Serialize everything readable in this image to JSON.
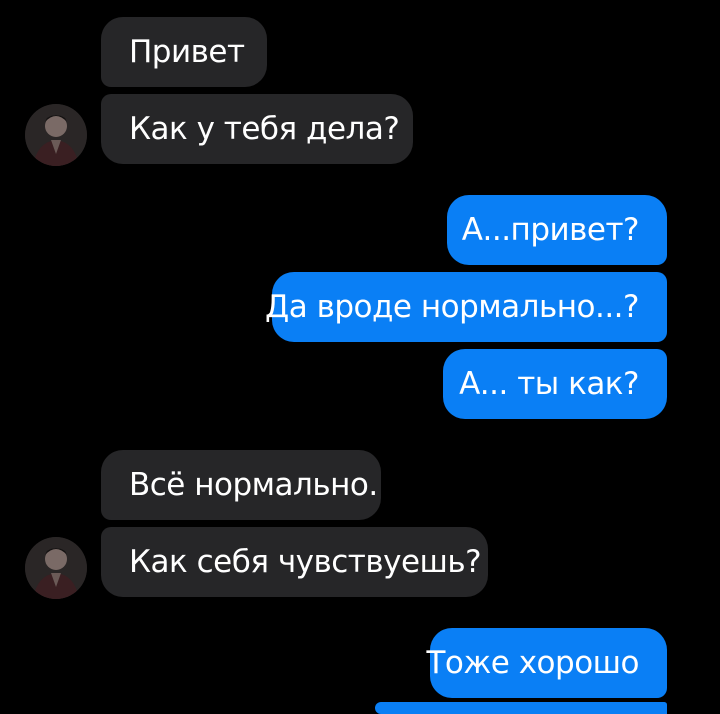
{
  "chat": {
    "messages": [
      {
        "text": "Привет",
        "from": "contact"
      },
      {
        "text": "Как у тебя дела?",
        "from": "contact"
      },
      {
        "text": "А...привет?",
        "from": "me"
      },
      {
        "text": "Да вроде нормально...?",
        "from": "me"
      },
      {
        "text": "А... ты как?",
        "from": "me"
      },
      {
        "text": "Всё нормально.",
        "from": "contact"
      },
      {
        "text": "Как себя чувствуешь?",
        "from": "contact"
      },
      {
        "text": "Тоже хорошо",
        "from": "me"
      }
    ],
    "contact_avatar_icon": "avatar-photo",
    "colors": {
      "background": "#000000",
      "incoming_bubble": "#262628",
      "outgoing_bubble": "#0a7ff5",
      "text": "#ffffff"
    }
  }
}
